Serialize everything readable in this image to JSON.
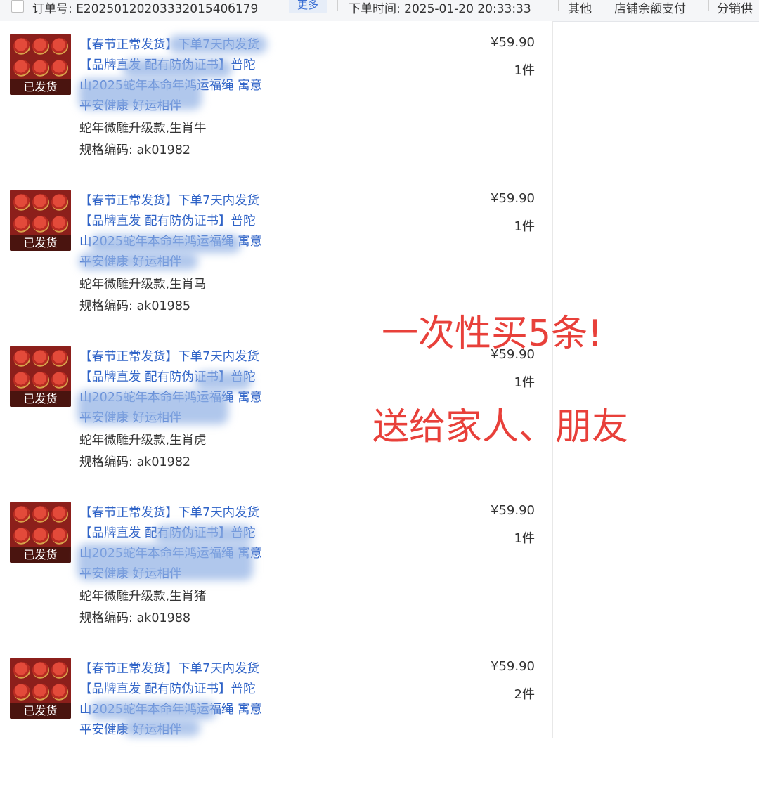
{
  "header": {
    "order_label": "订单号: E2025012020333201540б179",
    "more_button": "更多",
    "order_time": "下单时间: 2025-01-20 20:33:33",
    "tag_other": "其他",
    "tag_payment": "店铺余额支付",
    "tag_dist": "分销供"
  },
  "items": [
    {
      "status": "已发货",
      "title_lines": [
        "【春节正常发货】下单7天内发货",
        "【品牌直发 配有防伪证书】普陀",
        "山2025蛇年本命年鸿运福绳 寓意",
        "平安健康 好运相伴"
      ],
      "spec": "蛇年微雕升级款,生肖牛",
      "code": "规格编码: ak01982",
      "price": "¥59.90",
      "qty": "1件"
    },
    {
      "status": "已发货",
      "title_lines": [
        "【春节正常发货】下单7天内发货",
        "【品牌直发 配有防伪证书】普陀",
        "山2025蛇年本命年鸿运福绳 寓意",
        "平安健康 好运相伴"
      ],
      "spec": "蛇年微雕升级款,生肖马",
      "code": "规格编码: ak01985",
      "price": "¥59.90",
      "qty": "1件"
    },
    {
      "status": "已发货",
      "title_lines": [
        "【春节正常发货】下单7天内发货",
        "【品牌直发 配有防伪证书】普陀",
        "山2025蛇年本命年鸿运福绳 寓意",
        "平安健康 好运相伴"
      ],
      "spec": "蛇年微雕升级款,生肖虎",
      "code": "规格编码: ak01982",
      "price": "¥59.90",
      "qty": "1件"
    },
    {
      "status": "已发货",
      "title_lines": [
        "【春节正常发货】下单7天内发货",
        "【品牌直发 配有防伪证书】普陀",
        "山2025蛇年本命年鸿运福绳 寓意",
        "平安健康 好运相伴"
      ],
      "spec": "蛇年微雕升级款,生肖猪",
      "code": "规格编码: ak01988",
      "price": "¥59.90",
      "qty": "1件"
    },
    {
      "status": "已发货",
      "title_lines": [
        "【春节正常发货】下单7天内发货",
        "【品牌直发 配有防伪证书】普陀",
        "山2025蛇年本命年鸿运福绳 寓意",
        "平安健康 好运相伴"
      ],
      "spec": "",
      "code": "",
      "price": "¥59.90",
      "qty": "2件"
    }
  ],
  "annotations": {
    "line1": "一次性买5条!",
    "line2": "送给家人、朋友",
    "color": "#e8403a"
  },
  "colors": {
    "link": "#2f63c7",
    "badge_bg": "#4a140f",
    "thumb_bg": "#8c1f1b"
  }
}
